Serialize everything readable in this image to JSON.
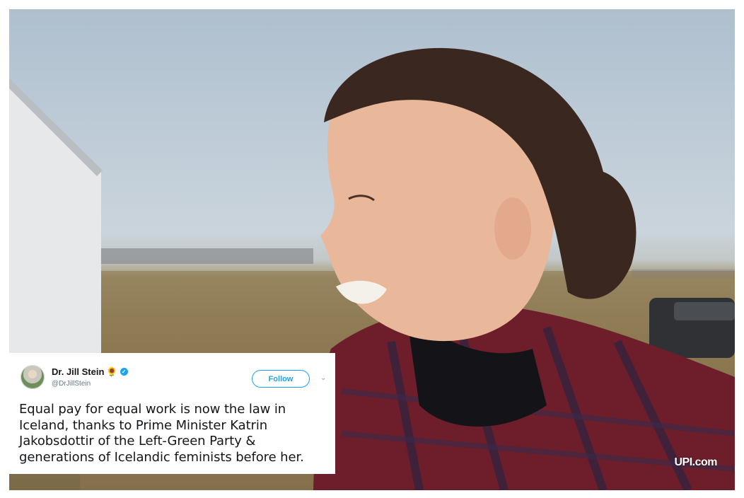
{
  "tweet": {
    "display_name": "Dr. Jill Stein",
    "emoji_icon": "sunflower-icon",
    "verified_icon": "verified-badge-icon",
    "handle": "@DrJillStein",
    "follow_label": "Follow",
    "menu_icon": "chevron-down-icon",
    "text_lines": [
      "Equal pay for equal work is now the law in",
      "Iceland, thanks to Prime Minister Katrin",
      "Jakobsdottir of the Left-Green Party &",
      "generations of Icelandic feminists before her."
    ],
    "accent_color": "#1da1f2"
  },
  "watermark": "UPI.com"
}
